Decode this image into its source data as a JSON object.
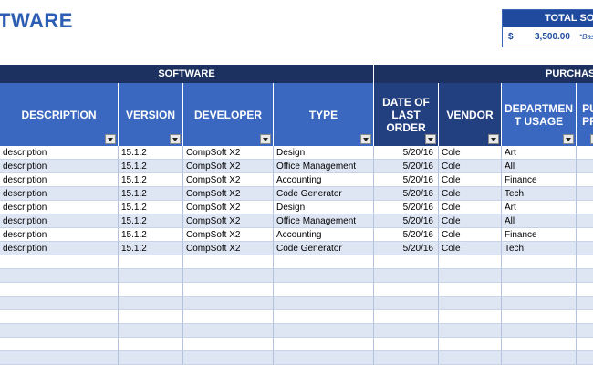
{
  "title": "TWARE",
  "total": {
    "header": "TOTAL SO",
    "currency": "$",
    "amount": "3,500.00",
    "note": "*Bas"
  },
  "groups": {
    "software": "SOFTWARE",
    "purchase": "PURCHAS"
  },
  "columns": [
    {
      "label": "DESCRIPTION",
      "tone": "blue"
    },
    {
      "label": "VERSION",
      "tone": "blue"
    },
    {
      "label": "DEVELOPER",
      "tone": "blue"
    },
    {
      "label": "TYPE",
      "tone": "blue"
    },
    {
      "label": "DATE OF LAST ORDER",
      "tone": "dark"
    },
    {
      "label": "VENDOR",
      "tone": "dark"
    },
    {
      "label": "DEPARTMEN T USAGE",
      "tone": "blue"
    },
    {
      "label": "PU PR",
      "tone": "blue"
    }
  ],
  "rows": [
    [
      "description",
      "15.1.2",
      "CompSoft X2",
      "Design",
      "5/20/16",
      "Cole",
      "Art",
      ""
    ],
    [
      "description",
      "15.1.2",
      "CompSoft X2",
      "Office Management",
      "5/20/16",
      "Cole",
      "All",
      ""
    ],
    [
      "description",
      "15.1.2",
      "CompSoft X2",
      "Accounting",
      "5/20/16",
      "Cole",
      "Finance",
      ""
    ],
    [
      "description",
      "15.1.2",
      "CompSoft X2",
      "Code Generator",
      "5/20/16",
      "Cole",
      "Tech",
      ""
    ],
    [
      "description",
      "15.1.2",
      "CompSoft X2",
      "Design",
      "5/20/16",
      "Cole",
      "Art",
      ""
    ],
    [
      "description",
      "15.1.2",
      "CompSoft X2",
      "Office Management",
      "5/20/16",
      "Cole",
      "All",
      ""
    ],
    [
      "description",
      "15.1.2",
      "CompSoft X2",
      "Accounting",
      "5/20/16",
      "Cole",
      "Finance",
      ""
    ],
    [
      "description",
      "15.1.2",
      "CompSoft X2",
      "Code Generator",
      "5/20/16",
      "Cole",
      "Tech",
      ""
    ],
    [
      "",
      "",
      "",
      "",
      "",
      "",
      "",
      ""
    ],
    [
      "",
      "",
      "",
      "",
      "",
      "",
      "",
      ""
    ],
    [
      "",
      "",
      "",
      "",
      "",
      "",
      "",
      ""
    ],
    [
      "",
      "",
      "",
      "",
      "",
      "",
      "",
      ""
    ],
    [
      "",
      "",
      "",
      "",
      "",
      "",
      "",
      ""
    ],
    [
      "",
      "",
      "",
      "",
      "",
      "",
      "",
      ""
    ],
    [
      "",
      "",
      "",
      "",
      "",
      "",
      "",
      ""
    ],
    [
      "",
      "",
      "",
      "",
      "",
      "",
      "",
      ""
    ]
  ]
}
